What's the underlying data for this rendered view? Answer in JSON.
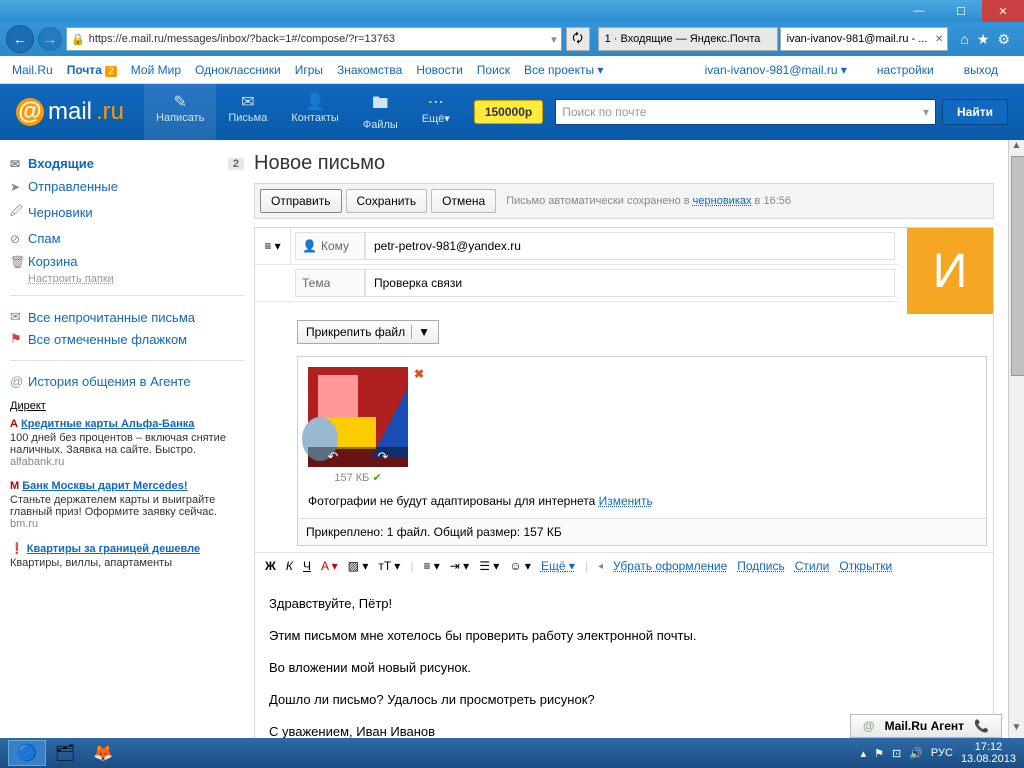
{
  "browser": {
    "url": "https://e.mail.ru/messages/inbox/?back=1#/compose/?r=13763",
    "tabs": [
      {
        "title": "1 · Входящие — Яндекс.Почта"
      },
      {
        "title": "ivan-ivanov-981@mail.ru - ..."
      }
    ]
  },
  "topnav": {
    "links": [
      "Mail.Ru",
      "Почта",
      "Мой Мир",
      "Одноклассники",
      "Игры",
      "Знакомства",
      "Новости",
      "Поиск",
      "Все проекты"
    ],
    "mail_badge": "2",
    "email": "ivan-ivanov-981@mail.ru",
    "settings": "настройки",
    "logout": "выход"
  },
  "header": {
    "logo_main": "mail",
    "logo_suffix": ".ru",
    "tabs": [
      {
        "icon": "✎",
        "label": "Написать"
      },
      {
        "icon": "✉",
        "label": "Письма"
      },
      {
        "icon": "👤",
        "label": "Контакты"
      },
      {
        "icon": "🖿",
        "label": "Файлы"
      },
      {
        "icon": "⋯",
        "label": "Ещё"
      }
    ],
    "price": "150000р",
    "search_placeholder": "Поиск по почте",
    "search_btn": "Найти"
  },
  "sidebar": {
    "folders": [
      {
        "icon": "✉",
        "label": "Входящие",
        "count": "2",
        "active": true
      },
      {
        "icon": "➤",
        "label": "Отправленные"
      },
      {
        "icon": "🖉",
        "label": "Черновики"
      },
      {
        "icon": "⊘",
        "label": "Спам"
      },
      {
        "icon": "🗑",
        "label": "Корзина"
      }
    ],
    "folder_settings": "Настроить папки",
    "filters": [
      {
        "icon": "✉",
        "label": "Все непрочитанные письма",
        "color": "#1068bf"
      },
      {
        "icon": "⚑",
        "label": "Все отмеченные флажком",
        "color": "#d04040"
      }
    ],
    "agent_history": "История общения в Агенте",
    "direkt_label": "Директ",
    "ads": [
      {
        "icon": "А",
        "title": "Кредитные карты Альфа-Банка",
        "text": "100 дней без процентов – включая снятие наличных. Заявка на сайте. Быстро.",
        "domain": "alfabank.ru"
      },
      {
        "icon": "М",
        "title": "Банк Москвы дарит Mercedes!",
        "text": "Станьте держателем карты и выиграйте главный приз! Оформите заявку сейчас.",
        "domain": "bm.ru"
      },
      {
        "icon": "❗",
        "title": "Квартиры за границей дешевле",
        "text": "Кварти­ры, виллы, апартаменты",
        "domain": ""
      }
    ]
  },
  "compose": {
    "title": "Новое письмо",
    "send": "Отправить",
    "save": "Сохранить",
    "cancel": "Отмена",
    "autosave_prefix": "Письмо автоматически сохранено в ",
    "autosave_link": "черновиках",
    "autosave_time": " в 16:56",
    "to_label": "Кому",
    "to_value": "petr-petrov-981@yandex.ru",
    "subject_label": "Тема",
    "subject_value": "Проверка связи",
    "avatar_letter": "И",
    "attach_btn": "Прикрепить файл",
    "attachment": {
      "size": "157 КБ",
      "note": "Фотографии не будут адаптированы для интернета ",
      "note_link": "Изменить",
      "summary": "Прикреплено: 1 файл. Общий размер: 157 КБ"
    },
    "toolbar": {
      "bold": "Ж",
      "italic": "К",
      "underline": "Ч",
      "more": "Ещё",
      "remove_format": "Убрать оформление",
      "signature": "Подпись",
      "styles": "Стили",
      "cards": "Открытки"
    },
    "body_lines": [
      "Здравствуйте, Пётр!",
      "Этим письмом мне хотелось бы проверить работу электронной почты.",
      "Во вложении мой новый рисунок.",
      "Дошло ли письмо? Удалось ли просмотреть рисунок?",
      "С уважением, Иван Иванов"
    ]
  },
  "agent_bar": "Mail.Ru Агент",
  "taskbar": {
    "lang": "РУС",
    "time": "17:12",
    "date": "13.08.2013"
  }
}
